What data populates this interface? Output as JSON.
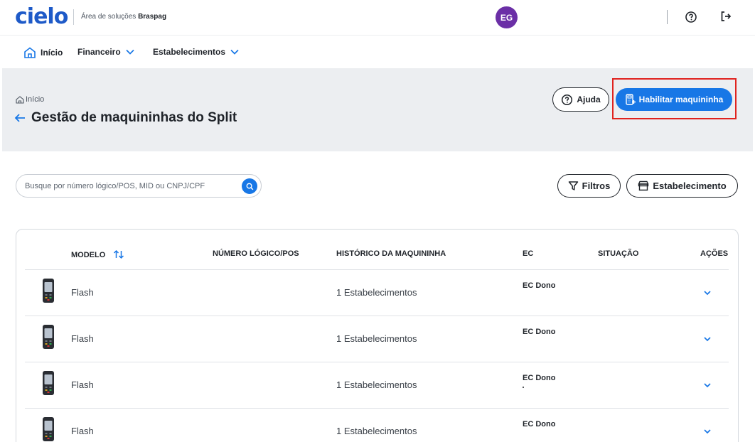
{
  "topbar": {
    "logo": "cielo",
    "subtitle_prefix": "Área de soluções",
    "subtitle_brand": "Braspag",
    "avatar_initials": "EG",
    "accent": "#1877e6",
    "avatar_color": "#6b2fa6"
  },
  "nav": {
    "items": [
      {
        "label": "Início"
      },
      {
        "label": "Financeiro"
      },
      {
        "label": "Estabelecimentos"
      }
    ]
  },
  "header": {
    "breadcrumb": "Início",
    "title": "Gestão de maquininhas do Split",
    "help_label": "Ajuda",
    "primary_label": "Habilitar maquininha"
  },
  "toolbar": {
    "search_placeholder": "Busque por número lógico/POS, MID ou CNPJ/CPF",
    "filters_label": "Filtros",
    "establishment_label": "Estabelecimento"
  },
  "table": {
    "columns": [
      "MODELO",
      "NÚMERO LÓGICO/POS",
      "HISTÓRICO DA MAQUININHA",
      "EC",
      "SITUAÇÃO",
      "AÇÕES"
    ],
    "rows": [
      {
        "model": "Flash",
        "history": "1 Estabelecimentos",
        "ec": "EC Dono"
      },
      {
        "model": "Flash",
        "history": "1 Estabelecimentos",
        "ec": "EC Dono"
      },
      {
        "model": "Flash",
        "history": "1 Estabelecimentos",
        "ec": "EC Dono"
      },
      {
        "model": "Flash",
        "history": "1 Estabelecimentos",
        "ec": "EC Dono"
      }
    ]
  }
}
